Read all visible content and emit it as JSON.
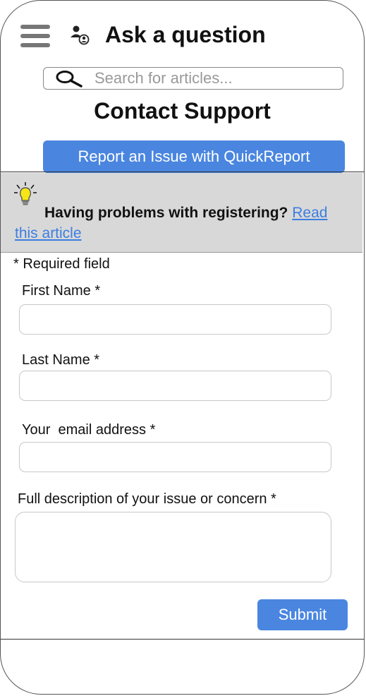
{
  "header": {
    "title": "Ask a question",
    "menu_icon": "hamburger-menu-icon",
    "people_icon": "people-icon"
  },
  "search": {
    "placeholder": "Search for articles...",
    "icon": "search-icon"
  },
  "section_title": "Contact Support",
  "report_button_label": "Report an Issue with QuickReport",
  "tip": {
    "icon": "lightbulb-icon",
    "lead": "Having problems with registering?",
    "link_text": "Read this article"
  },
  "form": {
    "required_note": "* Required field",
    "first_name_label": "First Name *",
    "last_name_label": "Last Name *",
    "email_label": "Your  email address *",
    "description_label": "Full description of your issue or concern *",
    "submit_label": "Submit"
  },
  "colors": {
    "accent": "#4a86e0",
    "link": "#3c7ee0",
    "tip_background": "#d8d8d8"
  }
}
